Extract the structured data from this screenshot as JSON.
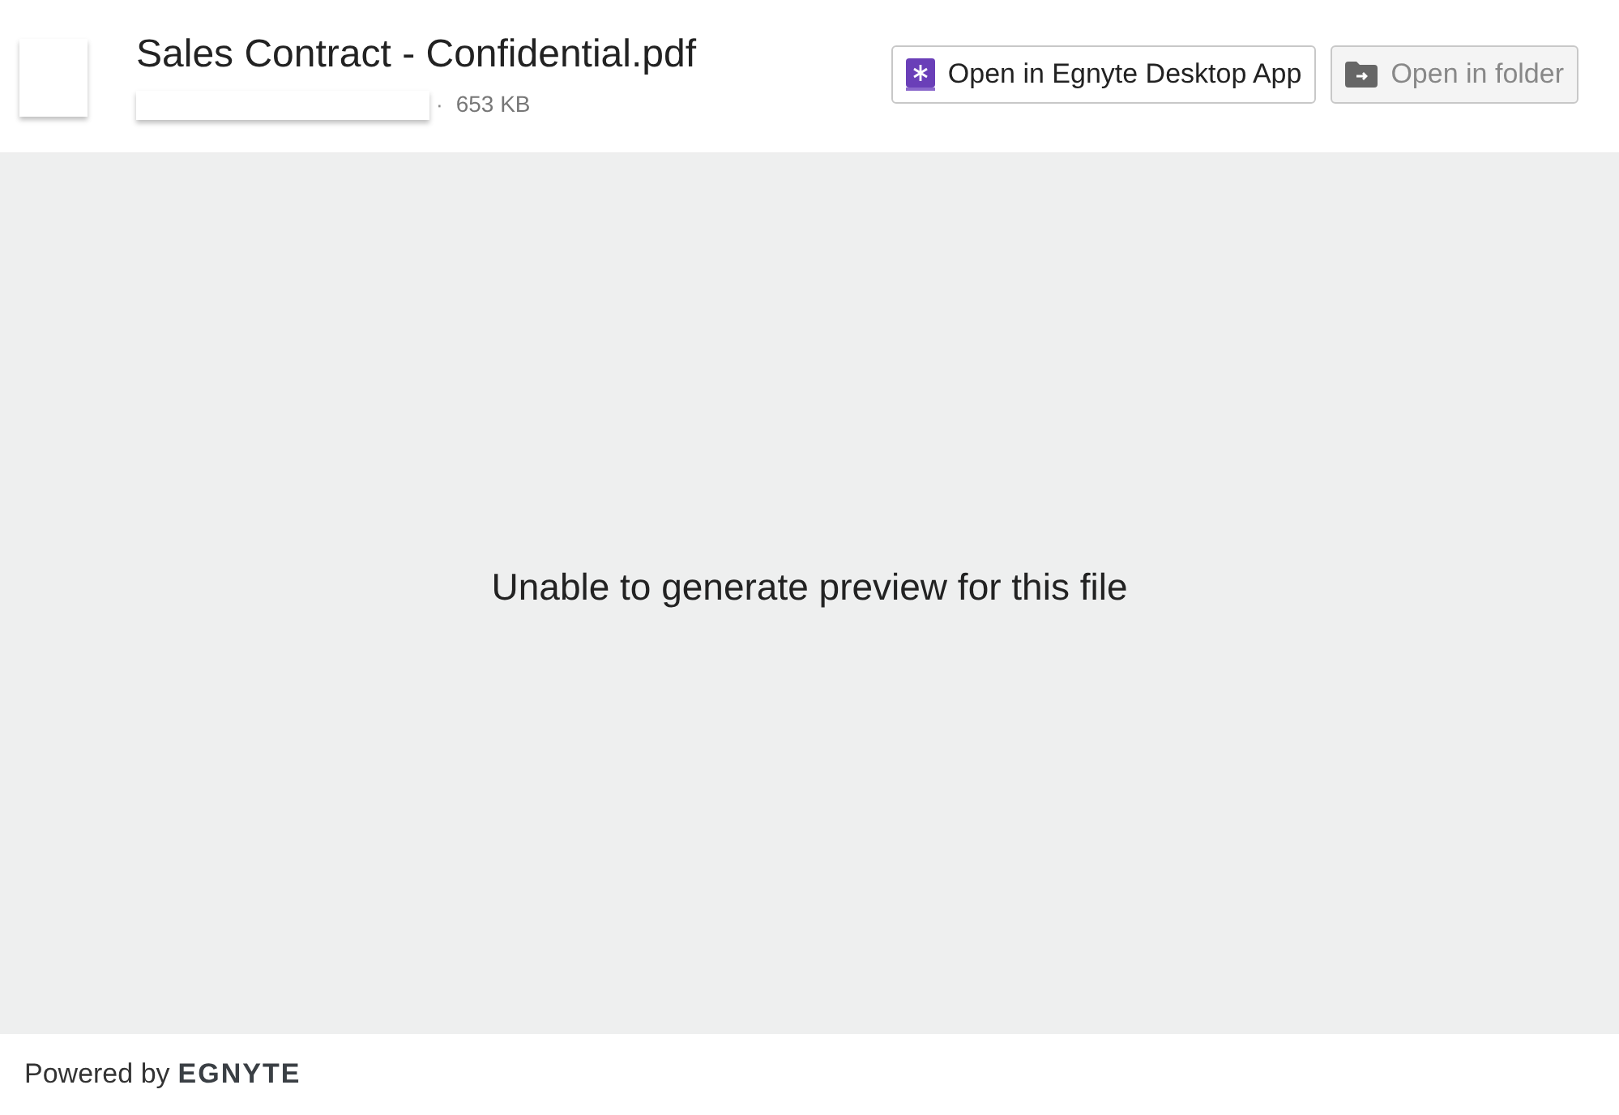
{
  "header": {
    "file_name": "Sales Contract - Confidential.pdf",
    "separator": "·",
    "file_size": "653 KB",
    "buttons": [
      {
        "label": "Open in Egnyte Desktop App",
        "kind": "app",
        "disabled": false
      },
      {
        "label": "Open in folder",
        "kind": "folder",
        "disabled": true
      }
    ]
  },
  "preview": {
    "message": "Unable to generate preview for this file"
  },
  "footer": {
    "powered_by": "Powered by",
    "logo": "EGNYTE"
  }
}
